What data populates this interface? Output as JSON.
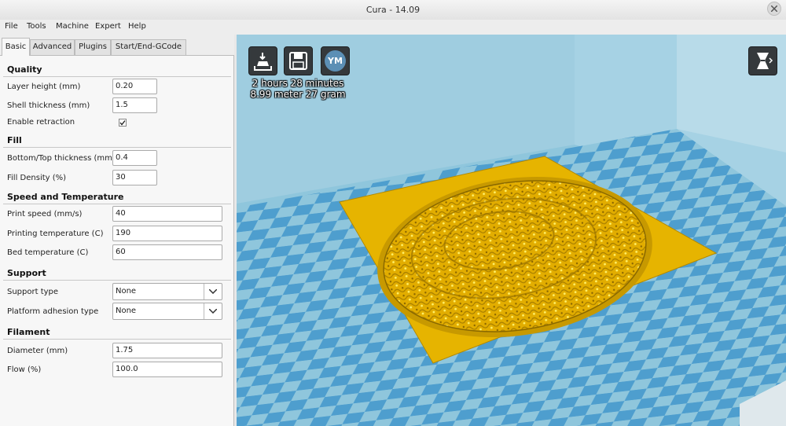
{
  "window": {
    "title": "Cura - 14.09"
  },
  "menu": [
    "File",
    "Tools",
    "Machine",
    "Expert",
    "Help"
  ],
  "tabs": [
    "Basic",
    "Advanced",
    "Plugins",
    "Start/End-GCode"
  ],
  "sections": {
    "quality": "Quality",
    "fill": "Fill",
    "speed": "Speed and Temperature",
    "support": "Support",
    "filament": "Filament"
  },
  "fields": {
    "layer_height": {
      "label": "Layer height (mm)",
      "value": "0.20"
    },
    "shell_thickness": {
      "label": "Shell thickness (mm)",
      "value": "1.5"
    },
    "enable_retraction": {
      "label": "Enable retraction",
      "checked": true
    },
    "bottom_top_thickness": {
      "label": "Bottom/Top thickness (mm)",
      "value": "0.4"
    },
    "fill_density": {
      "label": "Fill Density (%)",
      "value": "30"
    },
    "print_speed": {
      "label": "Print speed (mm/s)",
      "value": "40"
    },
    "printing_temperature": {
      "label": "Printing temperature (C)",
      "value": "190"
    },
    "bed_temperature": {
      "label": "Bed temperature (C)",
      "value": "60"
    },
    "support_type": {
      "label": "Support type",
      "value": "None"
    },
    "platform_adhesion": {
      "label": "Platform adhesion type",
      "value": "None"
    },
    "diameter": {
      "label": "Diameter (mm)",
      "value": "1.75"
    },
    "flow": {
      "label": "Flow (%)",
      "value": "100.0"
    }
  },
  "viewport": {
    "ym_label": "YM",
    "print_time": "2 hours 28 minutes",
    "print_material": "8.99 meter 27 gram",
    "colors": {
      "floor_light": "#8fc6dc",
      "floor_dark": "#4f9fcf",
      "model": "#e8b500",
      "toolbar": "#35393c"
    },
    "icons": [
      "load-model-icon",
      "save-gcode-icon",
      "youmagine-icon",
      "view-mode-icon"
    ]
  }
}
